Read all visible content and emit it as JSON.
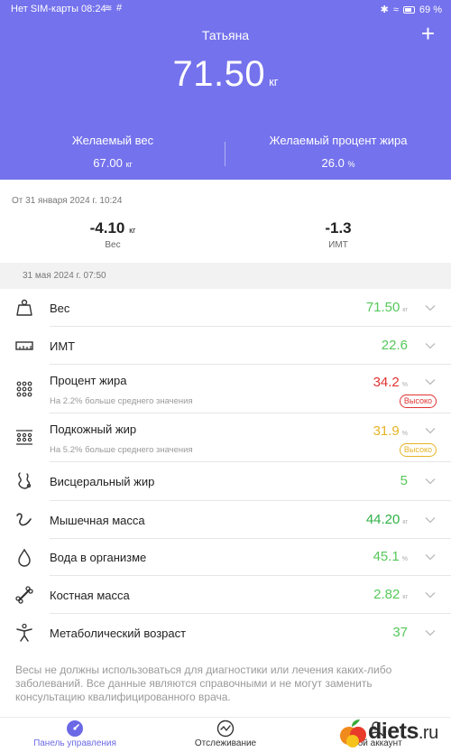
{
  "status_bar": {
    "carrier_time": "Нет SIM-карты 08:24",
    "battery": "69 %"
  },
  "header": {
    "user_name": "Татьяна",
    "weight_value": "71.50",
    "weight_unit": "кг",
    "target_weight_label": "Желаемый вес",
    "target_weight_value": "67.00",
    "target_weight_unit": "кг",
    "target_fat_label": "Желаемый процент жира",
    "target_fat_value": "26.0",
    "target_fat_unit": "%"
  },
  "since": {
    "label": "От 31 января 2024 г. 10:24",
    "weight_change": "-4.10",
    "weight_change_unit": "кг",
    "weight_change_label": "Вес",
    "bmi_change": "-1.3",
    "bmi_change_label": "ИМТ"
  },
  "measurement_date": "31 мая 2024 г. 07:50",
  "metrics": [
    {
      "icon": "weight-icon",
      "name": "Вес",
      "value": "71.50",
      "unit": "кг",
      "color": "#56c85a"
    },
    {
      "icon": "ruler-icon",
      "name": "ИМТ",
      "value": "22.6",
      "unit": "",
      "color": "#56c85a"
    },
    {
      "icon": "dots-grid-icon",
      "name": "Процент жира",
      "value": "34.2",
      "unit": "%",
      "color": "#e23232",
      "sub": "На 2.2% больше среднего значения",
      "badge": "Высоко"
    },
    {
      "icon": "subcutaneous-fat-icon",
      "name": "Подкожный жир",
      "value": "31.9",
      "unit": "%",
      "color": "#e6b325",
      "sub": "На 5.2% больше среднего значения",
      "badge": "Высоко"
    },
    {
      "icon": "visceral-fat-icon",
      "name": "Висцеральный жир",
      "value": "5",
      "unit": "",
      "color": "#56c85a"
    },
    {
      "icon": "muscle-icon",
      "name": "Мышечная масса",
      "value": "44.20",
      "unit": "кг",
      "color": "#2fb046"
    },
    {
      "icon": "water-drop-icon",
      "name": "Вода в организме",
      "value": "45.1",
      "unit": "%",
      "color": "#56c85a"
    },
    {
      "icon": "bone-icon",
      "name": "Костная масса",
      "value": "2.82",
      "unit": "кг",
      "color": "#56c85a"
    },
    {
      "icon": "metabolic-age-icon",
      "name": "Метаболический возраст",
      "value": "37",
      "unit": "",
      "color": "#56c85a"
    }
  ],
  "disclaimer": "Весы не должны использоваться для диагностики или лечения каких-либо заболеваний. Все данные являются справочными и не могут заменить консультацию квалифицированного врача.",
  "nav": {
    "dashboard": "Панель управления",
    "tracking": "Отслеживание",
    "account": "Мой аккаунт"
  },
  "watermark": {
    "site": "diets",
    "tld": ".ru"
  }
}
